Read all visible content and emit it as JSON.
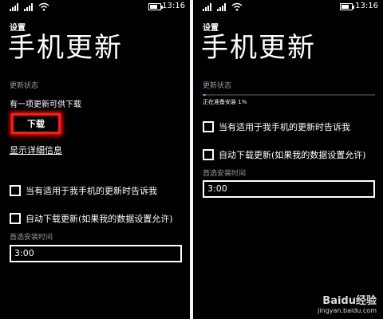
{
  "status_bar": {
    "time": "13:16"
  },
  "left": {
    "app_title": "设置",
    "page_title": "手机更新",
    "update_status_label": "更新状态",
    "update_status_text": "有一项更新可供下载",
    "download_button": "下载",
    "details_link": "显示详细信息",
    "notify_option": "当有适用于我手机的更新时告诉我",
    "auto_download_option": "自动下载更新(如果我的数据设置允许)",
    "install_time_label": "首选安装时间",
    "install_time_value": "3:00"
  },
  "right": {
    "app_title": "设置",
    "page_title": "手机更新",
    "update_status_label": "更新状态",
    "progress_text": "正在准备安装 1%",
    "progress": 0.01,
    "notify_option": "当有适用于我手机的更新时告诉我",
    "auto_download_option": "自动下载更新(如果我的数据设置允许)",
    "install_time_label": "首选安装时间",
    "install_time_value": "3:00"
  },
  "watermark": {
    "brand": "Baidu经验",
    "url": "jingyan.baidu.com"
  },
  "colors": {
    "highlight": "#ff1a1a",
    "progress": "#2ea6ff",
    "background": "#000000"
  }
}
